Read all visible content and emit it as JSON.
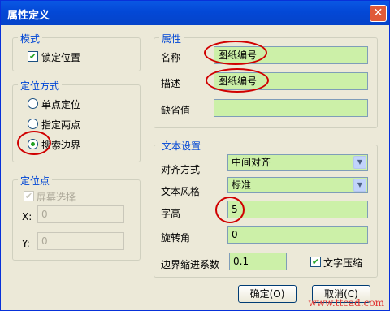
{
  "title": "属性定义",
  "mode": {
    "legend": "模式",
    "lock_label": "锁定位置"
  },
  "position": {
    "legend": "定位方式",
    "opt1": "单点定位",
    "opt2": "指定两点",
    "opt3": "搜索边界"
  },
  "point": {
    "legend": "定位点",
    "screen_label": "屏幕选择",
    "x_label": "X:",
    "x_value": "0",
    "y_label": "Y:",
    "y_value": "0"
  },
  "attr": {
    "legend": "属性",
    "name_label": "名称",
    "name_value": "图纸编号",
    "desc_label": "描述",
    "desc_value": "图纸编号",
    "default_label": "缺省值",
    "default_value": ""
  },
  "text": {
    "legend": "文本设置",
    "align_label": "对齐方式",
    "align_value": "中间对齐",
    "style_label": "文本风格",
    "style_value": "标准",
    "height_label": "字高",
    "height_value": "5",
    "rot_label": "旋转角",
    "rot_value": "0",
    "shrink_label": "边界缩进系数",
    "shrink_value": "0.1",
    "compress_label": "文字压缩"
  },
  "ok_label": "确定(O)",
  "cancel_label": "取消(C)",
  "watermark": "www.ttcad.com",
  "colors": {
    "field_bg": "#ccf0a8",
    "title_bar": "#0348d6",
    "highlight": "#d00000"
  }
}
